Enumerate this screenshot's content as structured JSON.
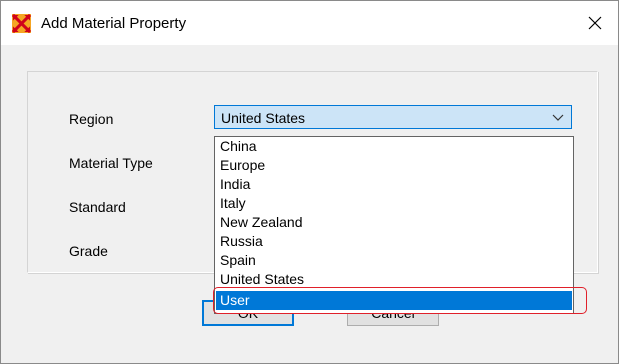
{
  "window": {
    "title": "Add Material Property",
    "close_symbol": "✕",
    "icon": "app-logo-icon"
  },
  "form": {
    "labels": {
      "region": "Region",
      "material_type": "Material Type",
      "standard": "Standard",
      "grade": "Grade"
    },
    "region": {
      "selected_value": "United States",
      "open": true,
      "options": [
        "China",
        "Europe",
        "India",
        "Italy",
        "New Zealand",
        "Russia",
        "Spain",
        "United States",
        "User"
      ],
      "highlighted_option": "User"
    }
  },
  "buttons": {
    "ok": "OK",
    "cancel": "Cancel"
  },
  "colors": {
    "selection": "#0078d7",
    "combo_background": "#cce4f7",
    "annotation": "#e0202a"
  }
}
